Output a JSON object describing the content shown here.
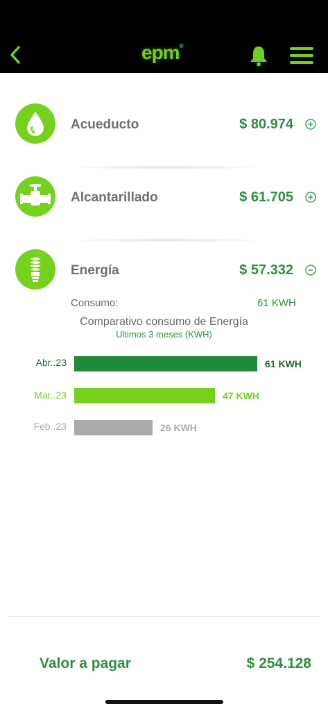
{
  "header": {
    "logo": "epm",
    "logo_mark": "®",
    "icons": [
      "back-arrow-icon",
      "bell-icon",
      "hamburger-menu-icon"
    ],
    "accent_color": "#6fd11f"
  },
  "services": [
    {
      "name": "Acueducto",
      "amount": "$ 80.974",
      "icon": "water-drop-icon",
      "expanded": false
    },
    {
      "name": "Alcantarillado",
      "amount": "$ 61.705",
      "icon": "pipe-valve-icon",
      "expanded": false
    },
    {
      "name": "Energía",
      "amount": "$ 57.332",
      "icon": "lightbulb-icon",
      "expanded": true
    }
  ],
  "energy_detail": {
    "consumo_label": "Consumo:",
    "consumo_value": "61 KWH",
    "chart_title": "Comparativo consumo de Energía",
    "chart_subtitle": "Ultimos 3 meses (KWH)"
  },
  "chart_data": {
    "type": "bar",
    "orientation": "horizontal",
    "title": "Comparativo consumo de Energía",
    "subtitle": "Ultimos 3 meses (KWH)",
    "categories": [
      "Abr..23",
      "Mar..23",
      "Feb..23"
    ],
    "values": [
      61,
      47,
      26
    ],
    "value_labels": [
      "61 KWH",
      "47 KWH",
      "26 KWH"
    ],
    "colors": [
      "#1e8a3c",
      "#76d11f",
      "#aaaaaa"
    ],
    "xlim": [
      0,
      61
    ],
    "grid": false
  },
  "footer": {
    "total_label": "Valor a pagar",
    "total_amount": "$ 254.128"
  }
}
